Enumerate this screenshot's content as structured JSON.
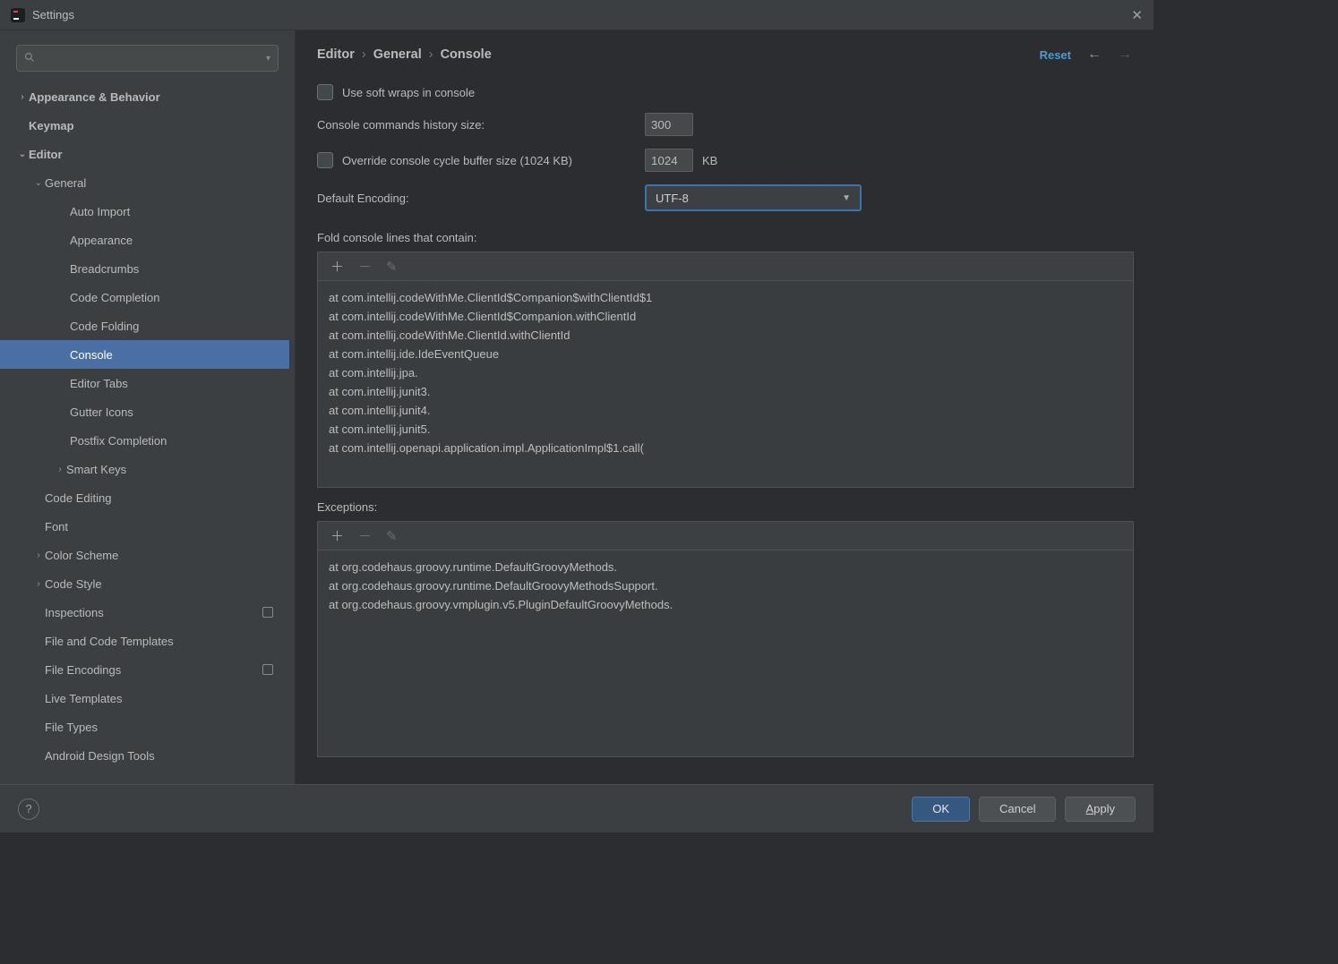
{
  "window": {
    "title": "Settings"
  },
  "sidebar": {
    "search_placeholder": "",
    "items": {
      "appearance_behavior": "Appearance & Behavior",
      "keymap": "Keymap",
      "editor": "Editor",
      "general": "General",
      "auto_import": "Auto Import",
      "appearance": "Appearance",
      "breadcrumbs": "Breadcrumbs",
      "code_completion": "Code Completion",
      "code_folding": "Code Folding",
      "console": "Console",
      "editor_tabs": "Editor Tabs",
      "gutter_icons": "Gutter Icons",
      "postfix_completion": "Postfix Completion",
      "smart_keys": "Smart Keys",
      "code_editing": "Code Editing",
      "font": "Font",
      "color_scheme": "Color Scheme",
      "code_style": "Code Style",
      "inspections": "Inspections",
      "file_code_templates": "File and Code Templates",
      "file_encodings": "File Encodings",
      "live_templates": "Live Templates",
      "file_types": "File Types",
      "android_design_tools": "Android Design Tools"
    }
  },
  "breadcrumb": [
    "Editor",
    "General",
    "Console"
  ],
  "header": {
    "reset": "Reset"
  },
  "form": {
    "soft_wraps_label": "Use soft wraps in console",
    "history_size_label": "Console commands history size:",
    "history_size_value": "300",
    "override_label": "Override console cycle buffer size (1024 KB)",
    "override_value": "1024",
    "kb": "KB",
    "encoding_label": "Default Encoding:",
    "encoding_value": "UTF-8",
    "fold_label": "Fold console lines that contain:",
    "fold_lines": [
      "at com.intellij.codeWithMe.ClientId$Companion$withClientId$1",
      "at com.intellij.codeWithMe.ClientId$Companion.withClientId",
      "at com.intellij.codeWithMe.ClientId.withClientId",
      "at com.intellij.ide.IdeEventQueue",
      "at com.intellij.jpa.",
      "at com.intellij.junit3.",
      "at com.intellij.junit4.",
      "at com.intellij.junit5.",
      "at com.intellij.openapi.application.impl.ApplicationImpl$1.call("
    ],
    "exceptions_label": "Exceptions:",
    "exceptions_lines": [
      "at org.codehaus.groovy.runtime.DefaultGroovyMethods.",
      "at org.codehaus.groovy.runtime.DefaultGroovyMethodsSupport.",
      "at org.codehaus.groovy.vmplugin.v5.PluginDefaultGroovyMethods."
    ]
  },
  "footer": {
    "ok": "OK",
    "cancel": "Cancel",
    "apply": "pply",
    "apply_mnemonic": "A"
  }
}
